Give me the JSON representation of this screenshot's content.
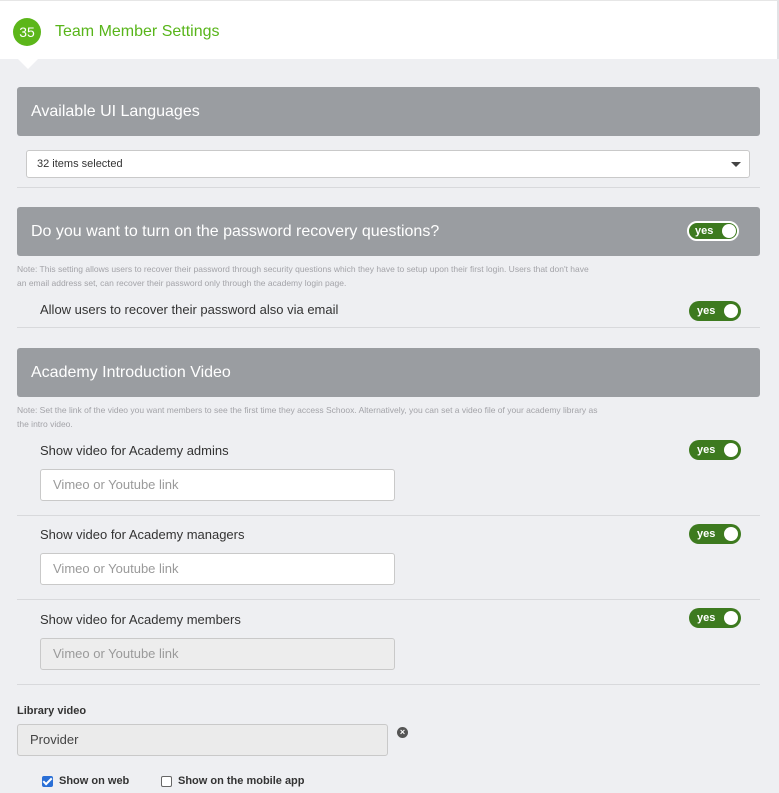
{
  "header": {
    "step_number": "35",
    "title": "Team Member Settings"
  },
  "languages": {
    "heading": "Available UI Languages",
    "select_value": "32 items selected"
  },
  "password_recovery": {
    "heading": "Do you want to turn on the password recovery questions?",
    "toggle_label": "yes",
    "note_line1": "Note: This setting allows users to recover their password through security questions which they have to setup upon their first login. Users that don't have",
    "note_line2": "an email address set, can recover their password only through the academy login page.",
    "email_recovery_label": "Allow users to recover their password also via email",
    "email_recovery_toggle": "yes"
  },
  "intro_video": {
    "heading": "Academy Introduction Video",
    "note_line1": "Note: Set the link of the video you want members to see the first time they access Schoox. Alternatively, you can set a video file of your academy library as",
    "note_line2": "the intro video.",
    "admins_label": "Show video for Academy admins",
    "admins_toggle": "yes",
    "admins_placeholder": "Vimeo or Youtube link",
    "managers_label": "Show video for Academy managers",
    "managers_toggle": "yes",
    "managers_placeholder": "Vimeo or Youtube link",
    "members_label": "Show video for Academy members",
    "members_toggle": "yes",
    "members_placeholder": "Vimeo or Youtube link"
  },
  "library_video": {
    "label": "Library video",
    "provider_value": "Provider",
    "show_on_web_label": "Show on web",
    "show_on_web_checked": true,
    "show_on_mobile_label": "Show on the mobile app",
    "show_on_mobile_checked": false
  },
  "colors": {
    "accent_green": "#5cb61a",
    "toggle_green": "#3d7a1f",
    "section_header_gray": "#9a9da1",
    "checkbox_blue": "#2a6fd6"
  }
}
